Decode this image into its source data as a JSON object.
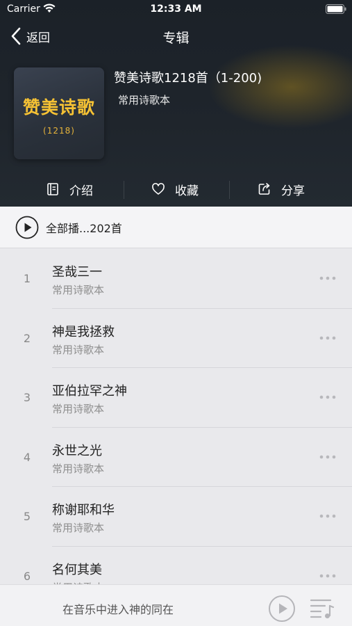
{
  "status": {
    "carrier": "Carrier",
    "time": "12:33 AM"
  },
  "nav": {
    "back_label": "返回",
    "title": "专辑"
  },
  "album": {
    "cover_title": "赞美诗歌",
    "cover_sub": "(1218)",
    "title": "赞美诗歌1218首（1-200)",
    "subtitle": "常用诗歌本"
  },
  "actions": {
    "intro": "介绍",
    "favorite": "收藏",
    "share": "分享"
  },
  "play_all": {
    "label": "全部播...202首"
  },
  "songs": [
    {
      "num": "1",
      "title": "圣哉三一",
      "sub": "常用诗歌本"
    },
    {
      "num": "2",
      "title": "神是我拯救",
      "sub": "常用诗歌本"
    },
    {
      "num": "3",
      "title": "亚伯拉罕之神",
      "sub": "常用诗歌本"
    },
    {
      "num": "4",
      "title": "永世之光",
      "sub": "常用诗歌本"
    },
    {
      "num": "5",
      "title": "称谢耶和华",
      "sub": "常用诗歌本"
    },
    {
      "num": "6",
      "title": "名何其美",
      "sub": "常用诗歌本"
    }
  ],
  "player": {
    "text": "在音乐中进入神的同在"
  },
  "colors": {
    "accent": "#f6c234",
    "header_bg": "#1f252c"
  },
  "icons": {
    "wifi": "wifi-icon",
    "battery": "battery-icon",
    "back": "chevron-left-icon",
    "intro": "book-icon",
    "favorite": "heart-icon",
    "share": "share-icon",
    "play": "play-circle-icon",
    "more": "ellipsis-icon",
    "playlist": "playlist-music-icon"
  }
}
